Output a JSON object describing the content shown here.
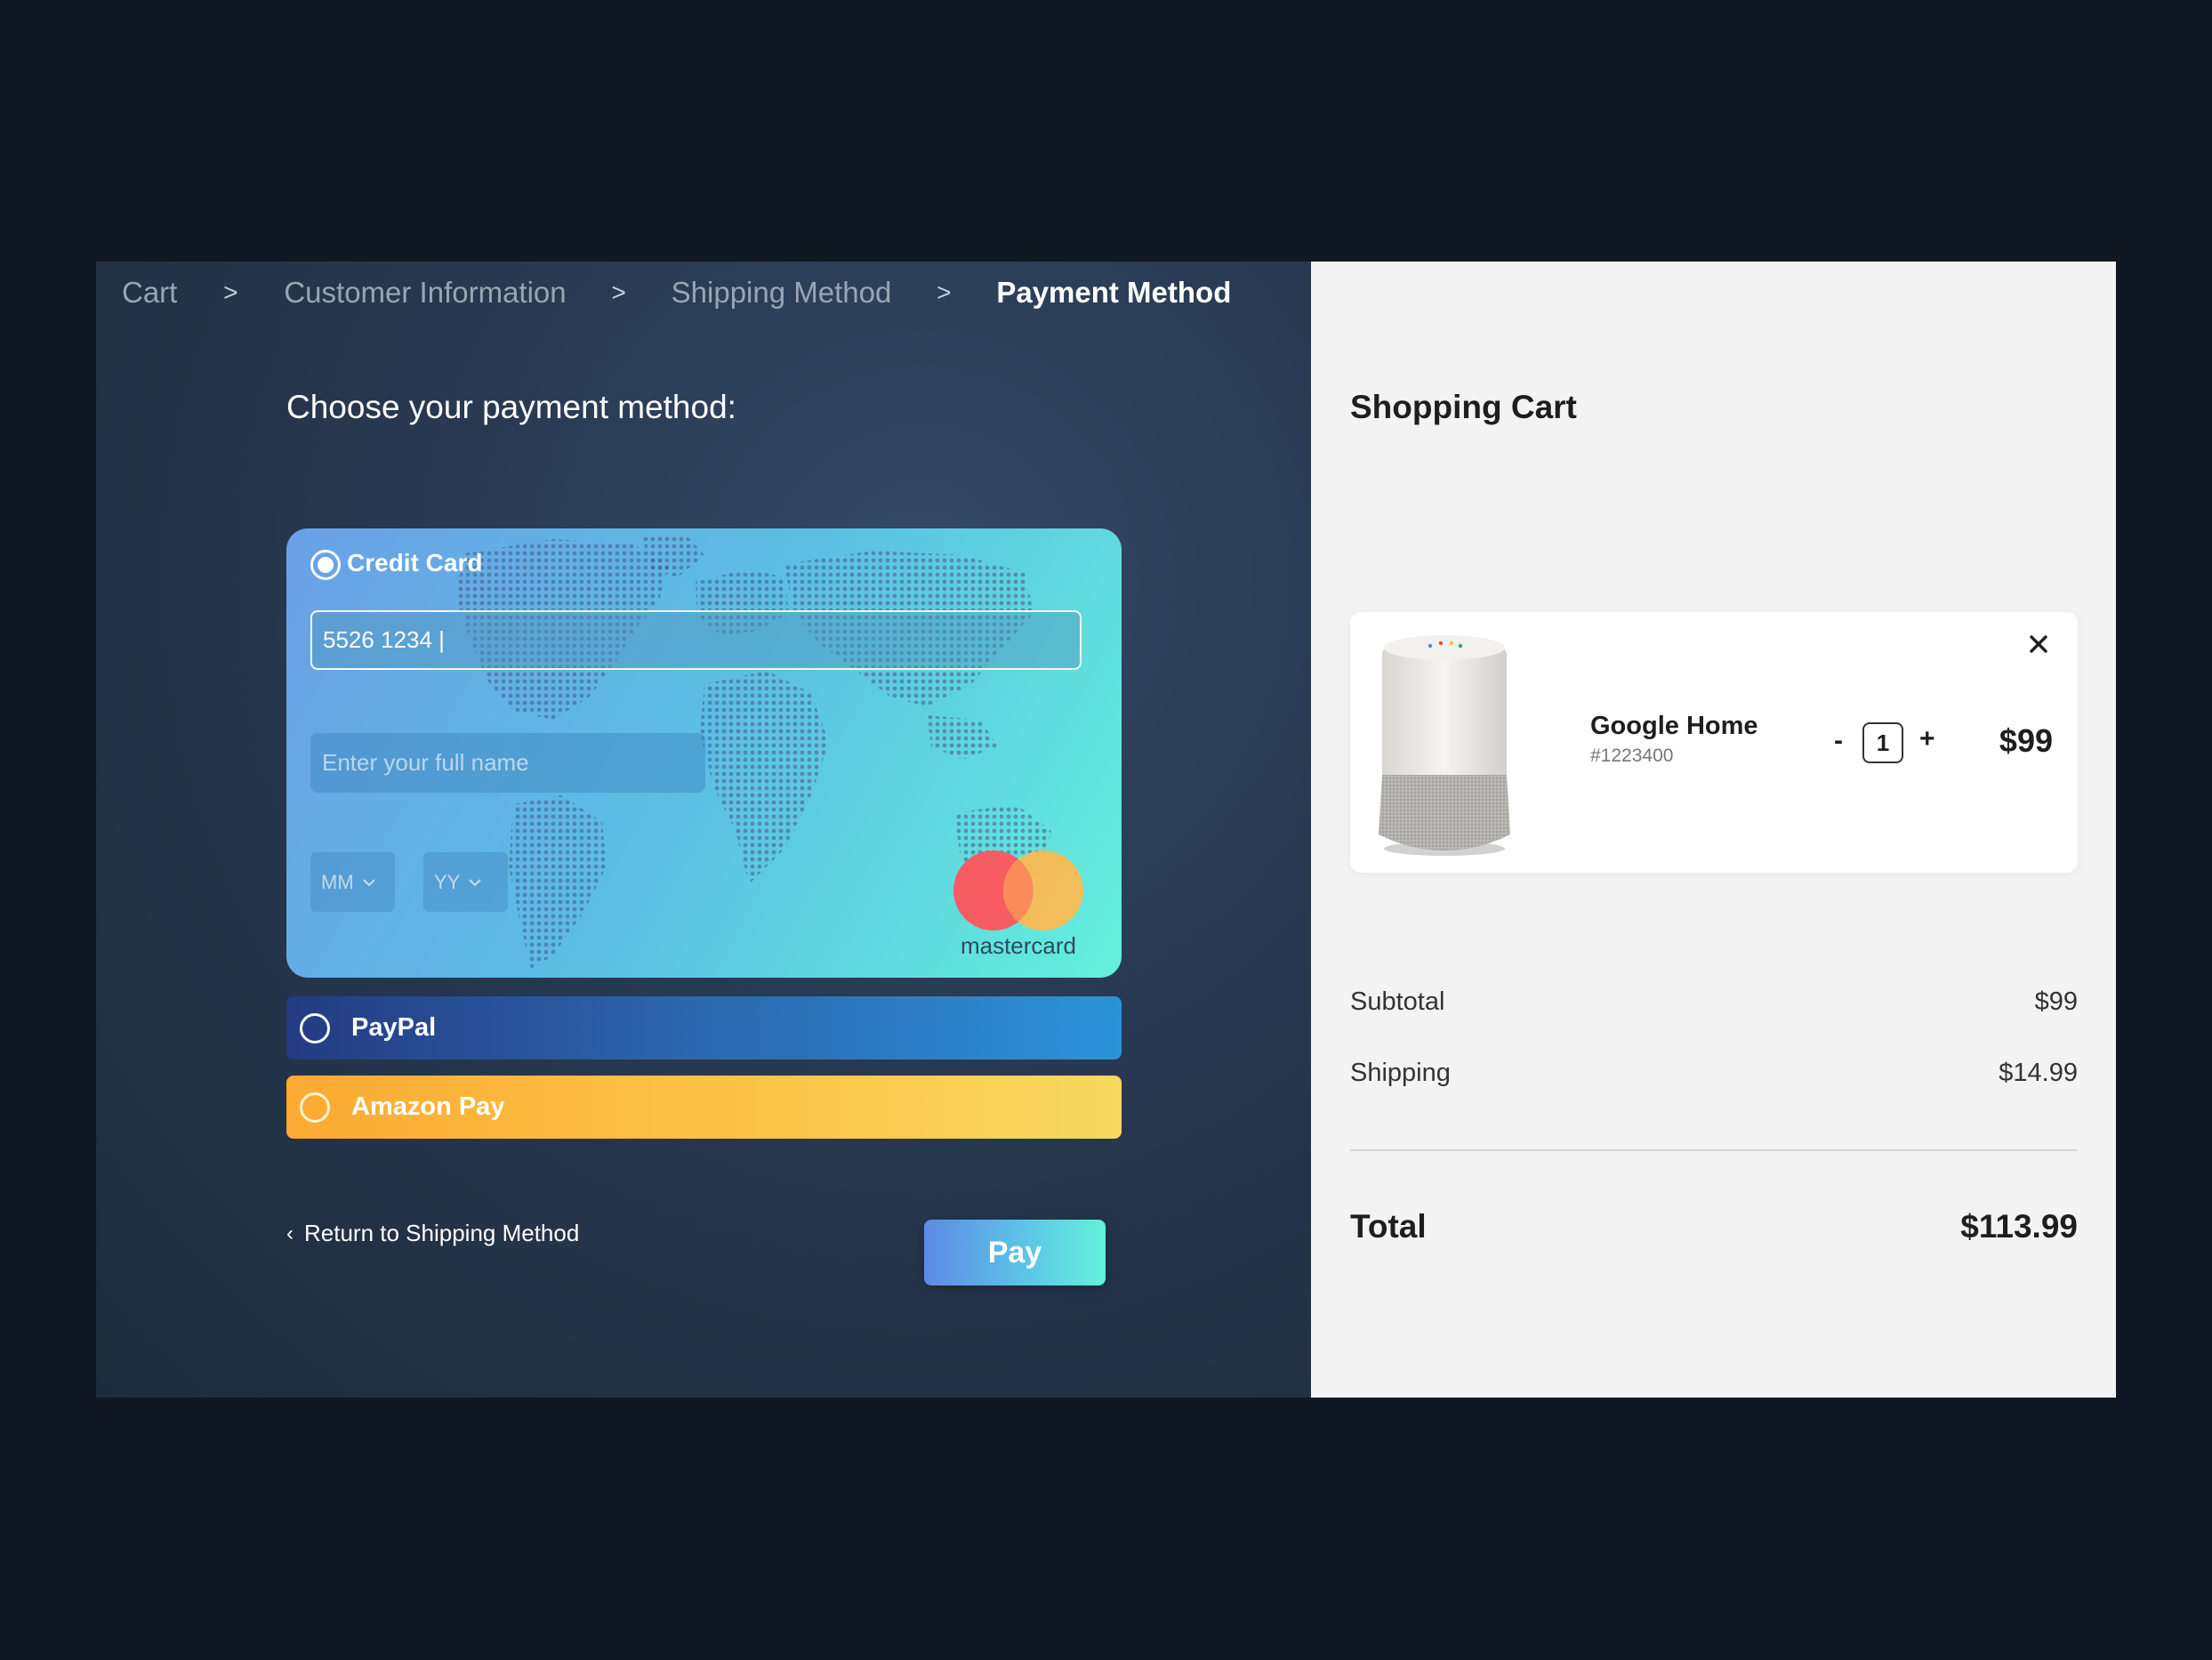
{
  "breadcrumb": {
    "items": [
      "Cart",
      "Customer Information",
      "Shipping Method",
      "Payment Method"
    ],
    "separator": ">",
    "active": "Payment Method"
  },
  "payment": {
    "heading": "Choose your payment method:",
    "credit_card": {
      "label": "Credit Card",
      "selected": true,
      "number_value": "5526 1234 |",
      "name_placeholder": "Enter your full name",
      "month_placeholder": "MM",
      "year_placeholder": "YY",
      "brand_text": "mastercard"
    },
    "paypal": {
      "label": "PayPal",
      "selected": false
    },
    "amazon_pay": {
      "label": "Amazon Pay",
      "selected": false
    },
    "back_link": "Return to Shipping Method",
    "pay_label": "Pay"
  },
  "cart": {
    "title": "Shopping Cart",
    "item": {
      "name": "Google Home",
      "sku": "#1223400",
      "quantity": "1",
      "minus": "-",
      "plus": "+",
      "price": "$99"
    },
    "subtotal_label": "Subtotal",
    "subtotal_value": "$99",
    "shipping_label": "Shipping",
    "shipping_value": "$14.99",
    "total_label": "Total",
    "total_value": "$113.99"
  },
  "colors": {
    "page_bg": "#101923",
    "left_panel": "#283a52",
    "right_panel": "#f3f3f3",
    "paypal_start": "#243b82",
    "paypal_end": "#2b93d9",
    "amazon_start": "#fcaa33",
    "amazon_end": "#f8d85f",
    "mastercard_red": "#f75c63",
    "mastercard_orange": "#fdb951"
  },
  "icons": [
    "chevron-right-icon",
    "chevron-down-icon",
    "chevron-left-icon",
    "close-icon",
    "mastercard-logo",
    "radio-icon"
  ]
}
